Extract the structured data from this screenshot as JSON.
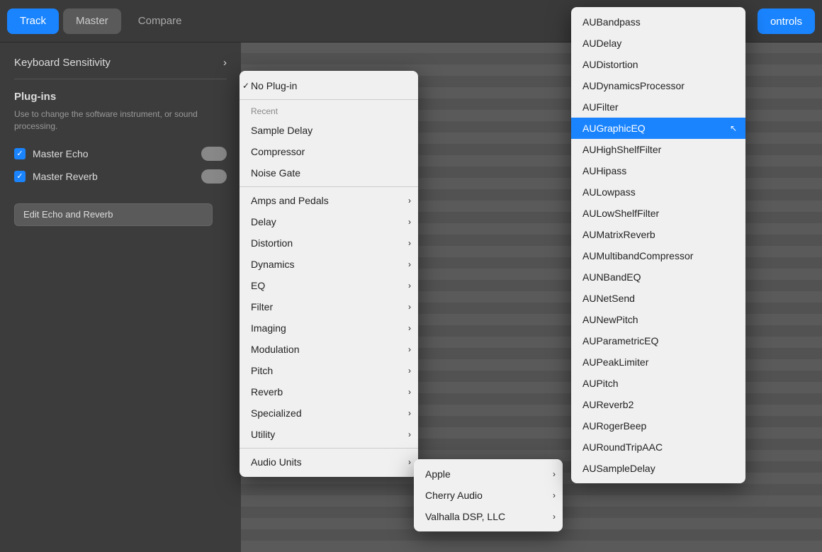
{
  "toolbar": {
    "track_label": "Track",
    "master_label": "Master",
    "compare_label": "Compare",
    "controls_label": "ontrols"
  },
  "left_panel": {
    "keyboard_sensitivity_label": "Keyboard Sensitivity",
    "plugins_heading": "Plug-ins",
    "plugins_desc": "Use to change the software instrument, or sound processing.",
    "master_echo_label": "Master Echo",
    "master_reverb_label": "Master Reverb",
    "edit_btn_label": "Edit Echo and Reverb"
  },
  "dropdown1": {
    "no_plugin_label": "No Plug-in",
    "recent_label": "Recent",
    "items": [
      {
        "id": "sample-delay",
        "label": "Sample Delay",
        "arrow": false
      },
      {
        "id": "compressor",
        "label": "Compressor",
        "arrow": false
      },
      {
        "id": "noise-gate",
        "label": "Noise Gate",
        "arrow": false
      }
    ],
    "categories": [
      {
        "id": "amps-pedals",
        "label": "Amps and Pedals",
        "arrow": true
      },
      {
        "id": "delay",
        "label": "Delay",
        "arrow": true
      },
      {
        "id": "distortion",
        "label": "Distortion",
        "arrow": true
      },
      {
        "id": "dynamics",
        "label": "Dynamics",
        "arrow": true
      },
      {
        "id": "eq",
        "label": "EQ",
        "arrow": true
      },
      {
        "id": "filter",
        "label": "Filter",
        "arrow": true
      },
      {
        "id": "imaging",
        "label": "Imaging",
        "arrow": true
      },
      {
        "id": "modulation",
        "label": "Modulation",
        "arrow": true
      },
      {
        "id": "pitch",
        "label": "Pitch",
        "arrow": true
      },
      {
        "id": "reverb",
        "label": "Reverb",
        "arrow": true
      },
      {
        "id": "specialized",
        "label": "Specialized",
        "arrow": true
      },
      {
        "id": "utility",
        "label": "Utility",
        "arrow": true
      }
    ],
    "audio_units": {
      "label": "Audio Units",
      "arrow": true
    }
  },
  "dropdown2": {
    "items": [
      {
        "id": "apple",
        "label": "Apple",
        "arrow": true
      },
      {
        "id": "cherry-audio",
        "label": "Cherry Audio",
        "arrow": true
      },
      {
        "id": "valhalla-dsp",
        "label": "Valhalla DSP, LLC",
        "arrow": true
      }
    ]
  },
  "dropdown3": {
    "items": [
      {
        "id": "aubandpass",
        "label": "AUBandpass",
        "selected": false
      },
      {
        "id": "audelay",
        "label": "AUDelay",
        "selected": false
      },
      {
        "id": "audistortion",
        "label": "AUDistortion",
        "selected": false
      },
      {
        "id": "audynamicsprocessor",
        "label": "AUDynamicsProcessor",
        "selected": false
      },
      {
        "id": "aufilter",
        "label": "AUFilter",
        "selected": false
      },
      {
        "id": "augraphiceq",
        "label": "AUGraphicEQ",
        "selected": true
      },
      {
        "id": "auhighshelffilter",
        "label": "AUHighShelfFilter",
        "selected": false
      },
      {
        "id": "auhipass",
        "label": "AUHipass",
        "selected": false
      },
      {
        "id": "aulowpass",
        "label": "AULowpass",
        "selected": false
      },
      {
        "id": "aulowshelffilter",
        "label": "AULowShelfFilter",
        "selected": false
      },
      {
        "id": "aumatrixreverb",
        "label": "AUMatrixReverb",
        "selected": false
      },
      {
        "id": "aumultibandcompressor",
        "label": "AUMultibandCompressor",
        "selected": false
      },
      {
        "id": "aunbandeq",
        "label": "AUNBandEQ",
        "selected": false
      },
      {
        "id": "aunetsend",
        "label": "AUNetSend",
        "selected": false
      },
      {
        "id": "aunewpitch",
        "label": "AUNewPitch",
        "selected": false
      },
      {
        "id": "auparametriceq",
        "label": "AUParametricEQ",
        "selected": false
      },
      {
        "id": "aupeaklimiter",
        "label": "AUPeakLimiter",
        "selected": false
      },
      {
        "id": "aupitch",
        "label": "AUPitch",
        "selected": false
      },
      {
        "id": "aureverb2",
        "label": "AUReverb2",
        "selected": false
      },
      {
        "id": "aurogerbeep",
        "label": "AURogerBeep",
        "selected": false
      },
      {
        "id": "auroundtripaac",
        "label": "AURoundTripAAC",
        "selected": false
      },
      {
        "id": "ausampledelay",
        "label": "AUSampleDelay",
        "selected": false
      }
    ]
  }
}
